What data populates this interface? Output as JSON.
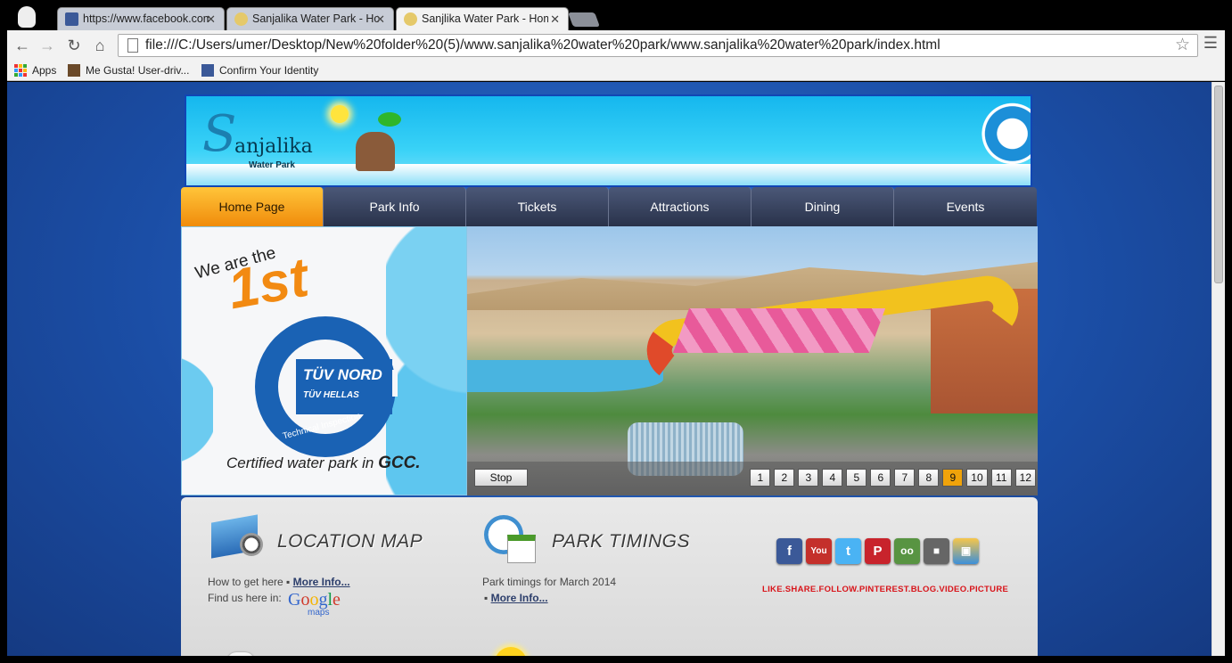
{
  "browser": {
    "tabs": [
      {
        "label": "https://www.facebook.com",
        "active": false
      },
      {
        "label": "Sanjalika Water Park - Hom",
        "active": false
      },
      {
        "label": "Sanjlika Water Park - Hom",
        "active": true
      }
    ],
    "url": "file:///C:/Users/umer/Desktop/New%20folder%20(5)/www.sanjalika%20water%20park/www.sanjalika%20water%20park/index.html",
    "bookmarks": [
      {
        "label": "Apps",
        "icon": "apps-icon"
      },
      {
        "label": "Me Gusta! User-driv...",
        "icon": "meme-icon"
      },
      {
        "label": "Confirm Your Identity",
        "icon": "facebook-icon"
      }
    ]
  },
  "site": {
    "logo": {
      "initial": "S",
      "name": "anjalika",
      "sub": "Water Park"
    },
    "nav": [
      "Home Page",
      "Park Info",
      "Tickets",
      "Attractions",
      "Dining",
      "Events"
    ],
    "badge": {
      "line1": "We are the",
      "line2": "1st",
      "tuv": "TÜV NORD",
      "tuv2": "TÜV HELLAS",
      "ring": "Technical Inspection",
      "cert_prefix": "Certified water park in",
      "cert_bold": "GCC."
    },
    "slider": {
      "stop_label": "Stop",
      "pages": [
        "1",
        "2",
        "3",
        "4",
        "5",
        "6",
        "7",
        "8",
        "9",
        "10",
        "11",
        "12"
      ],
      "active_page": "9"
    },
    "location": {
      "title": "LOCATION MAP",
      "line1": "How to get here",
      "more": "More Info...",
      "line2": "Find us here in:",
      "google": "Google",
      "maps": "maps"
    },
    "timings": {
      "title": "PARK TIMINGS",
      "line1": "Park timings for March 2014",
      "more": "More Info..."
    },
    "social": {
      "icons": [
        "facebook-icon",
        "youtube-icon",
        "twitter-icon",
        "pinterest-icon",
        "tripadvisor-icon",
        "video-camera-icon",
        "pictures-icon"
      ],
      "tagline": "LIKE.SHARE.FOLLOW.PINTEREST.BLOG.VIDEO.PICTURE"
    }
  }
}
